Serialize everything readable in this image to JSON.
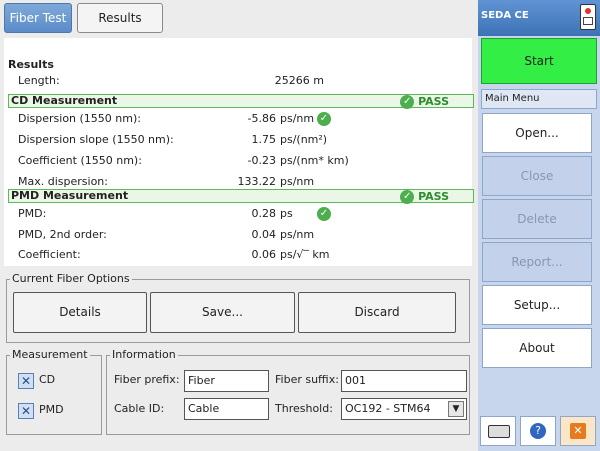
{
  "tabs": [
    {
      "label": "Fiber Test",
      "active": true
    },
    {
      "label": "Results",
      "active": false
    }
  ],
  "results": {
    "heading": "Results",
    "length": {
      "label": "Length:",
      "value": "25266 m"
    },
    "cd": {
      "title": "CD Measurement",
      "status": "PASS",
      "rows": [
        {
          "label": "Dispersion (1550 nm):",
          "value": "-5.86",
          "unit": "ps/nm",
          "check": true
        },
        {
          "label": "Dispersion slope (1550 nm):",
          "value": "1.75",
          "unit": "ps/(nm²)",
          "check": false
        },
        {
          "label": "Coefficient (1550 nm):",
          "value": "-0.23",
          "unit": "ps/(nm* km)",
          "check": false
        },
        {
          "label": "Max. dispersion:",
          "value": "133.22",
          "unit": "ps/nm",
          "check": false
        }
      ]
    },
    "pmd": {
      "title": "PMD Measurement",
      "status": "PASS",
      "rows": [
        {
          "label": "PMD:",
          "value": "0.28",
          "unit": "ps",
          "check": true
        },
        {
          "label": "PMD, 2nd order:",
          "value": "0.04",
          "unit": "ps/nm",
          "check": false
        },
        {
          "label": "Coefficient:",
          "value": "0.06",
          "unit": "ps/√‾ km",
          "check": false
        }
      ]
    }
  },
  "fiber_options": {
    "title": "Current Fiber Options",
    "details": "Details",
    "save": "Save...",
    "discard": "Discard"
  },
  "measurement": {
    "title": "Measurement",
    "cd_label": "CD",
    "pmd_label": "PMD",
    "cd_checked": true,
    "pmd_checked": true
  },
  "information": {
    "title": "Information",
    "fiber_prefix_label": "Fiber prefix:",
    "fiber_prefix_value": "Fiber",
    "fiber_suffix_label": "Fiber suffix:",
    "fiber_suffix_value": "001",
    "cable_id_label": "Cable ID:",
    "cable_id_value": "Cable",
    "threshold_label": "Threshold:",
    "threshold_value": "OC192 - STM64"
  },
  "sidebar": {
    "title": "SEDA CE",
    "start": "Start",
    "menu_title": "Main Menu",
    "items": [
      {
        "label": "Open...",
        "enabled": true
      },
      {
        "label": "Close",
        "enabled": false
      },
      {
        "label": "Delete",
        "enabled": false
      },
      {
        "label": "Report...",
        "enabled": false
      },
      {
        "label": "Setup...",
        "enabled": true
      },
      {
        "label": "About",
        "enabled": true
      }
    ],
    "bottom_icons": [
      "keyboard-icon",
      "help-icon",
      "close-icon"
    ]
  },
  "colors": {
    "accent_blue": "#5b8cc8",
    "start_green": "#33ee44",
    "pass_green": "#2e8b2e",
    "section_border": "#5cb85c"
  }
}
